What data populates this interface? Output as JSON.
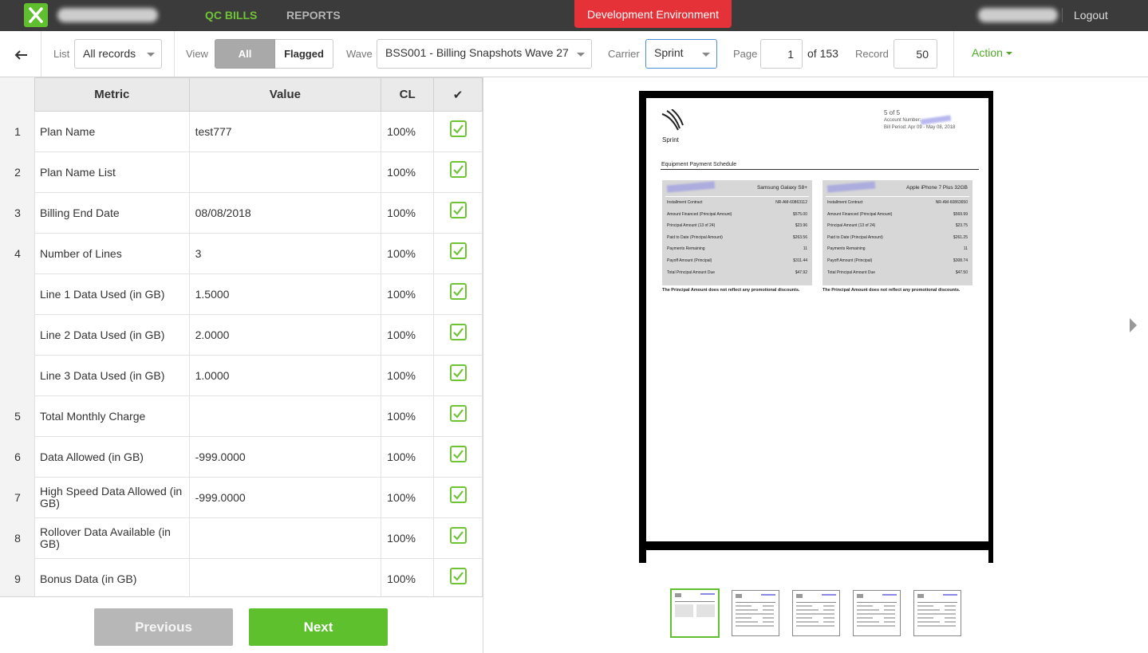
{
  "header": {
    "nav_qc": "QC BILLS",
    "nav_reports": "REPORTS",
    "environment": "Development Environment",
    "logout": "Logout"
  },
  "toolbar": {
    "list_label": "List",
    "list_value": "All records",
    "view_label": "View",
    "view_all": "All",
    "view_flagged": "Flagged",
    "wave_label": "Wave",
    "wave_value": "BSS001 - Billing Snapshots Wave 27",
    "carrier_label": "Carrier",
    "carrier_value": "Sprint",
    "page_label": "Page",
    "page_value": "1",
    "page_total": "of 153",
    "record_label": "Record",
    "record_value": "50",
    "action": "Action"
  },
  "table": {
    "headers": [
      "Metric",
      "Value",
      "CL",
      "✔"
    ],
    "rows": [
      {
        "num": "1",
        "metric": "Plan Name",
        "value": "test777",
        "cl": "100%"
      },
      {
        "num": "2",
        "metric": "Plan Name List",
        "value": "",
        "cl": "100%"
      },
      {
        "num": "3",
        "metric": "Billing End Date",
        "value": "08/08/2018",
        "cl": "100%"
      },
      {
        "num": "4",
        "metric": "Number of Lines",
        "value": "3",
        "cl": "100%"
      },
      {
        "num": "",
        "metric": "Line 1 Data Used (in GB)",
        "value": "1.5000",
        "cl": "100%"
      },
      {
        "num": "",
        "metric": "Line 2 Data Used (in GB)",
        "value": "2.0000",
        "cl": "100%"
      },
      {
        "num": "",
        "metric": "Line 3 Data Used (in GB)",
        "value": "1.0000",
        "cl": "100%"
      },
      {
        "num": "5",
        "metric": "Total Monthly Charge",
        "value": "",
        "cl": "100%"
      },
      {
        "num": "6",
        "metric": "Data Allowed (in GB)",
        "value": "-999.0000",
        "cl": "100%"
      },
      {
        "num": "7",
        "metric": "High Speed Data Allowed (in GB)",
        "value": "-999.0000",
        "cl": "100%"
      },
      {
        "num": "8",
        "metric": "Rollover Data Available (in GB)",
        "value": "",
        "cl": "100%"
      },
      {
        "num": "9",
        "metric": "Bonus Data (in GB)",
        "value": "",
        "cl": "100%"
      }
    ]
  },
  "buttons": {
    "previous": "Previous",
    "next": "Next"
  },
  "document": {
    "page_indicator": "5 of 5",
    "account_number_label": "Account Number:",
    "bill_period": "Bill Period: Apr 09 - May 08, 2018",
    "brand": "Sprint",
    "section_title": "Equipment Payment Schedule",
    "devices": [
      {
        "name": "Samsung Galaxy S8+",
        "rows": [
          [
            "Installment Contract",
            "NR-AM-60863112"
          ],
          [
            "Amount Financed (Principal Amount)",
            "$575.00"
          ],
          [
            "Principal Amount (13 of 24)",
            "$23.96"
          ],
          [
            "Paid to Date (Principal Amount)",
            "$263.56"
          ],
          [
            "Payments Remaining",
            "11"
          ],
          [
            "Payoff Amount (Principal)",
            "$311.44"
          ],
          [
            "Total Principal Amount Due",
            "$47.92"
          ]
        ]
      },
      {
        "name": "Apple iPhone 7 Plus 32GB",
        "rows": [
          [
            "Installment Contract",
            "NR-AM-60863650"
          ],
          [
            "Amount Financed (Principal Amount)",
            "$569.99"
          ],
          [
            "Principal Amount (13 of 24)",
            "$23.75"
          ],
          [
            "Paid to Date (Principal Amount)",
            "$261.25"
          ],
          [
            "Payments Remaining",
            "11"
          ],
          [
            "Payoff Amount (Principal)",
            "$308.74"
          ],
          [
            "Total Principal Amount Due",
            "$47.50"
          ]
        ]
      }
    ],
    "disclaimer": "The Principal Amount does not reflect any promotional discounts."
  },
  "thumbnails": {
    "count": 5,
    "active_index": 0
  }
}
